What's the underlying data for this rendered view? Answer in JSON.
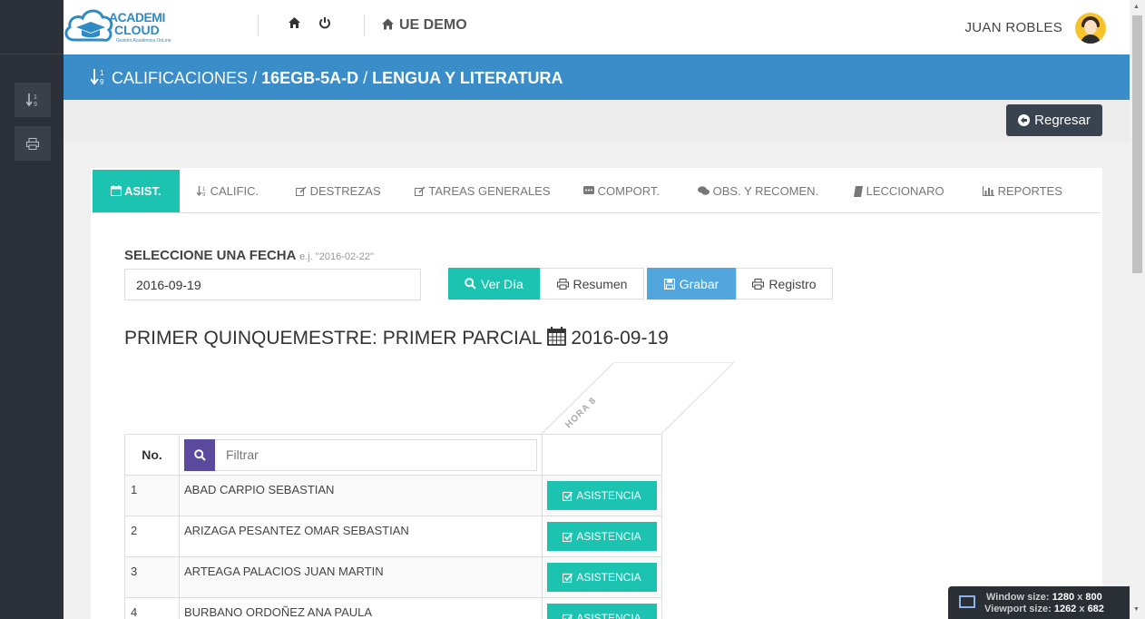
{
  "topbar": {
    "logo_line1": "ACADEMI",
    "logo_line2": "CLOUD",
    "logo_sub": "Gestión Académica OnLine",
    "org_name": "UE DEMO",
    "user_name": "JUAN ROBLES"
  },
  "header": {
    "section": "CALIFICACIONES",
    "separator": "/",
    "course": "16EGB-5A-D",
    "subject": "LENGUA Y LITERATURA"
  },
  "actions": {
    "back_label": "Regresar"
  },
  "tabs": [
    {
      "label": "ASIST.",
      "icon": "calendar-icon",
      "active": true
    },
    {
      "label": "CALIFIC.",
      "icon": "sort-numeric-icon"
    },
    {
      "label": "DESTREZAS",
      "icon": "edit-icon"
    },
    {
      "label": "TAREAS GENERALES",
      "icon": "edit-icon"
    },
    {
      "label": "COMPORT.",
      "icon": "comment-square-icon"
    },
    {
      "label": "OBS. Y RECOMEN.",
      "icon": "comments-icon"
    },
    {
      "label": "LECCIONARO",
      "icon": "book-icon"
    },
    {
      "label": "REPORTES",
      "icon": "bar-chart-icon"
    }
  ],
  "form": {
    "date_label": "SELECCIONE UNA FECHA",
    "date_hint": "e.j. \"2016-02-22\"",
    "date_value": "2016-09-19"
  },
  "buttons": {
    "ver_dia": "Ver Día",
    "resumen": "Resumen",
    "grabar": "Grabar",
    "registro": "Registro"
  },
  "period": {
    "title": "PRIMER QUINQUEMESTRE: PRIMER PARCIAL",
    "date": "2016-09-19"
  },
  "table": {
    "col_no": "No.",
    "filter_placeholder": "Filtrar",
    "hour_header": "HORA 8",
    "students": [
      {
        "no": "1",
        "name": "ABAD CARPIO SEBASTIAN",
        "status": "ASISTENCIA"
      },
      {
        "no": "2",
        "name": "ARIZAGA PESANTEZ OMAR SEBASTIAN",
        "status": "ASISTENCIA"
      },
      {
        "no": "3",
        "name": "ARTEAGA PALACIOS JUAN MARTIN",
        "status": "ASISTENCIA"
      },
      {
        "no": "4",
        "name": "BURBANO ORDOÑEZ ANA PAULA",
        "status": "ASISTENCIA"
      }
    ]
  },
  "overlay": {
    "window_label": "Window size:",
    "window_w": "1280",
    "window_h": "800",
    "viewport_label": "Viewport size:",
    "viewport_w": "1262",
    "viewport_h": "682",
    "x": "x"
  },
  "colors": {
    "teal": "#1bc3b0",
    "header_blue": "#3b8dc9",
    "grabar_blue": "#52a6de",
    "sidebar_dark": "#2c3038",
    "filter_purple": "#5b4a9d"
  }
}
